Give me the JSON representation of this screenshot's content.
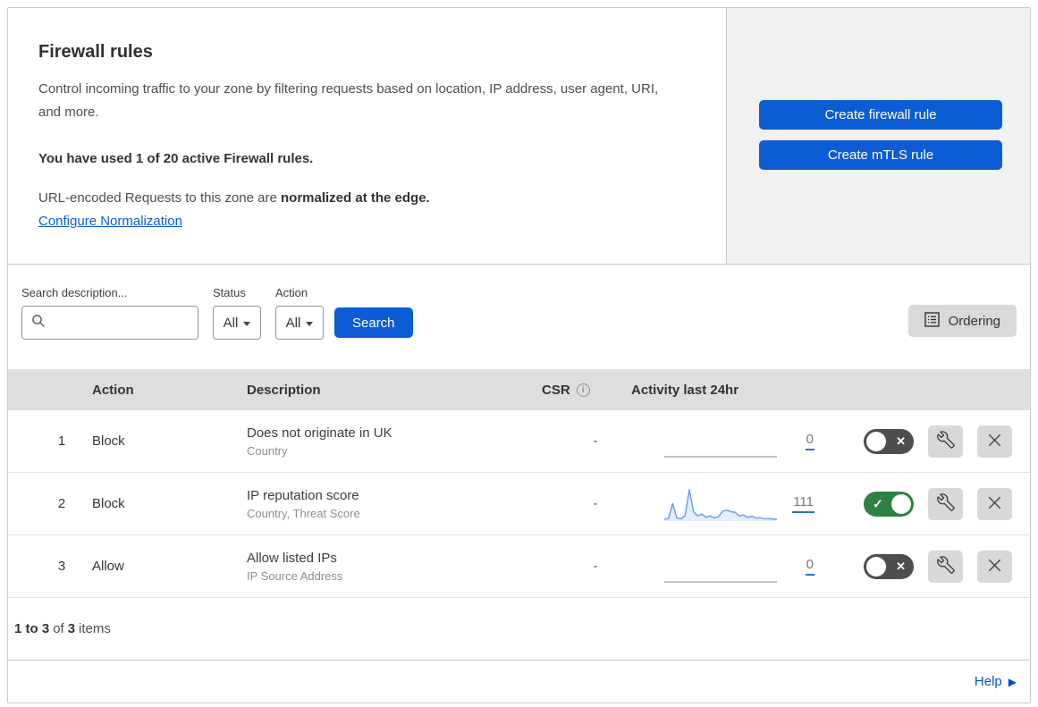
{
  "colors": {
    "accent_blue": "#0b5cd5",
    "toggle_on_green": "#2e8043",
    "toggle_off_gray": "#4d4d4d",
    "sparkline_blue": "#6d9eea",
    "link_blue": "#0b5cd5"
  },
  "header_card": {
    "title": "Firewall rules",
    "description": "Control incoming traffic to your zone by filtering requests based on location, IP address, user agent, URI, and more.",
    "usage_note": "You have used 1 of 20 active Firewall rules.",
    "normalization_prefix": "URL-encoded Requests to this zone are ",
    "normalization_bold": "normalized at the edge.",
    "normalization_link": "Configure Normalization"
  },
  "actions_panel": {
    "create_firewall_button": "Create firewall rule",
    "create_mtls_button": "Create mTLS rule"
  },
  "filter_bar": {
    "search_label": "Search description...",
    "search_value": "",
    "status_label": "Status",
    "status_value": "All",
    "action_label": "Action",
    "action_value": "All",
    "search_button": "Search",
    "ordering_button": "Ordering"
  },
  "table": {
    "headers": {
      "action": "Action",
      "description": "Description",
      "csr": "CSR",
      "activity": "Activity last 24hr"
    },
    "rows": [
      {
        "index": "1",
        "action": "Block",
        "description": "Does not originate in UK",
        "fields": "Country",
        "csr": "-",
        "activity_count": "0",
        "enabled": false
      },
      {
        "index": "2",
        "action": "Block",
        "description": "IP reputation score",
        "fields": "Country, Threat Score",
        "csr": "-",
        "activity_count": "111",
        "enabled": true,
        "sparkline": [
          3,
          6,
          55,
          8,
          4,
          15,
          100,
          28,
          14,
          20,
          10,
          14,
          7,
          12,
          30,
          33,
          28,
          26,
          14,
          17,
          9,
          13,
          7,
          8,
          5,
          5,
          4,
          3
        ]
      },
      {
        "index": "3",
        "action": "Allow",
        "description": "Allow listed IPs",
        "fields": "IP Source Address",
        "csr": "-",
        "activity_count": "0",
        "enabled": false
      }
    ]
  },
  "footer": {
    "range": "1 to 3",
    "of_word": "of",
    "total": "3",
    "items_word": "items"
  },
  "help": {
    "label": "Help"
  }
}
